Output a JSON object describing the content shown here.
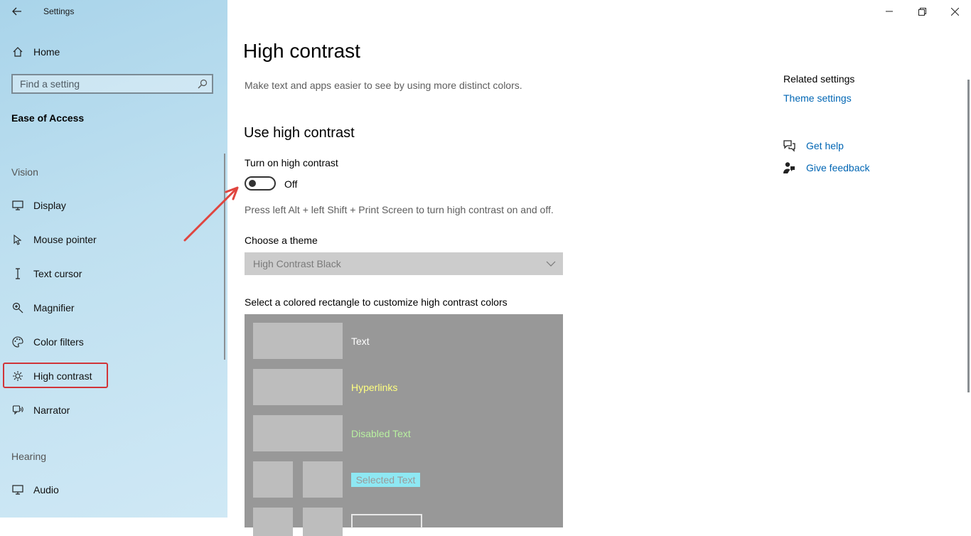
{
  "window": {
    "title": "Settings",
    "controls": {
      "minimize": "minimize",
      "restore": "restore",
      "close": "close"
    }
  },
  "sidebar": {
    "home": {
      "label": "Home",
      "icon": "home-icon"
    },
    "search": {
      "placeholder": "Find a setting",
      "icon": "search-icon"
    },
    "category": "Ease of Access",
    "vision_heading": "Vision",
    "items": [
      {
        "label": "Display",
        "icon": "display-icon"
      },
      {
        "label": "Mouse pointer",
        "icon": "mouse-pointer-icon"
      },
      {
        "label": "Text cursor",
        "icon": "text-cursor-icon"
      },
      {
        "label": "Magnifier",
        "icon": "magnifier-icon"
      },
      {
        "label": "Color filters",
        "icon": "color-filters-icon"
      },
      {
        "label": "High contrast",
        "icon": "high-contrast-icon",
        "selected": true
      },
      {
        "label": "Narrator",
        "icon": "narrator-icon"
      }
    ],
    "hearing_heading": "Hearing",
    "hearing_items": [
      {
        "label": "Audio",
        "icon": "audio-icon"
      }
    ],
    "highlight_color": "#d13438"
  },
  "main": {
    "title": "High contrast",
    "description": "Make text and apps easier to see by using more distinct colors.",
    "section_title": "Use high contrast",
    "toggle": {
      "label": "Turn on high contrast",
      "state": "Off"
    },
    "shortcut_hint": "Press left Alt + left Shift + Print Screen to turn high contrast on and off.",
    "theme": {
      "label": "Choose a theme",
      "selected": "High Contrast Black"
    },
    "palette": {
      "label": "Select a colored rectangle to customize high contrast colors",
      "entries": [
        {
          "label": "Text",
          "color": "#ffffff"
        },
        {
          "label": "Hyperlinks",
          "color": "#ffff80"
        },
        {
          "label": "Disabled Text",
          "color": "#b8f0a0"
        },
        {
          "label": "Selected Text",
          "color": "#8ee8f3"
        }
      ]
    }
  },
  "related": {
    "title": "Related settings",
    "theme_settings": "Theme settings",
    "get_help": "Get help",
    "give_feedback": "Give feedback",
    "link_color": "#0066b4"
  },
  "annotation": {
    "arrow_color": "#e0453f"
  }
}
